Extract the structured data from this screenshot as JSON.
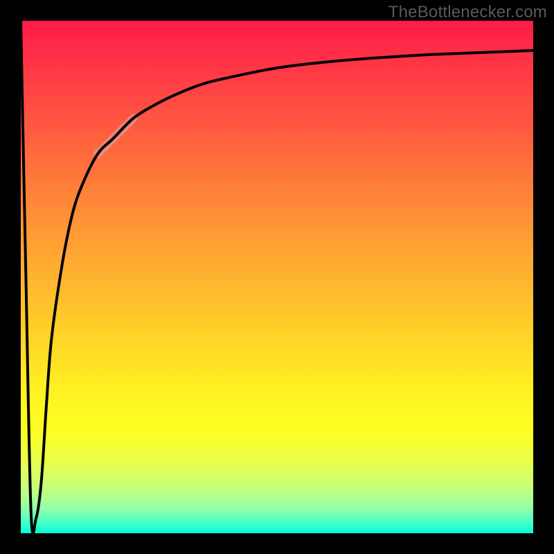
{
  "watermark": "TheBottlenecker.com",
  "colors": {
    "frame": "#000000",
    "curve": "#000000",
    "highlight": "#d8a9aa",
    "gradient_top": "#ff1a4a",
    "gradient_mid": "#ffd726",
    "gradient_bottom": "#00ffd5"
  },
  "chart_data": {
    "type": "line",
    "title": "",
    "xlabel": "",
    "ylabel": "",
    "xlim": [
      0,
      100
    ],
    "ylim": [
      0,
      100
    ],
    "grid": false,
    "legend": false,
    "series": [
      {
        "name": "bottleneck-curve",
        "x": [
          0,
          1,
          2,
          3,
          4,
          5,
          6,
          8,
          10,
          12,
          15,
          18,
          22,
          26,
          30,
          35,
          40,
          50,
          60,
          70,
          80,
          90,
          100
        ],
        "y": [
          100,
          50,
          4,
          3,
          10,
          25,
          38,
          52,
          62,
          68,
          74,
          77,
          81,
          83.5,
          85.5,
          87.5,
          88.8,
          90.8,
          92,
          92.8,
          93.4,
          93.8,
          94.2
        ]
      }
    ],
    "annotations": [
      {
        "name": "highlight-segment",
        "series": "bottleneck-curve",
        "x_range": [
          15,
          22
        ],
        "color": "#d8a9aa",
        "width": 12,
        "opacity": 0.55
      }
    ]
  }
}
